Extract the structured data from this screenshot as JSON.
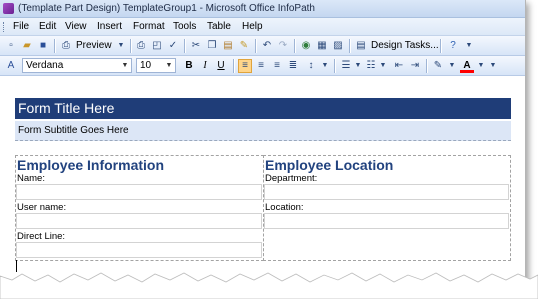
{
  "window": {
    "title": "(Template Part Design) TemplateGroup1 - Microsoft Office InfoPath"
  },
  "menu": {
    "items": [
      "File",
      "Edit",
      "View",
      "Insert",
      "Format",
      "Tools",
      "Table",
      "Help"
    ]
  },
  "toolbar_standard": {
    "preview_label": "Preview",
    "design_tasks_label": "Design Tasks...",
    "icons": [
      "new-icon",
      "open-icon",
      "save-icon",
      "preview-icon",
      "print-icon",
      "print-preview-icon",
      "spelling-icon",
      "cut-icon",
      "copy-icon",
      "paste-icon",
      "format-painter-icon",
      "undo-icon",
      "redo-icon",
      "insert-hyperlink-icon",
      "insert-table-icon",
      "insert-picture-icon",
      "design-tasks-icon",
      "help-icon",
      "toolbar-options-icon"
    ]
  },
  "toolbar_formatting": {
    "font_family": "Verdana",
    "font_size": "10",
    "bold_label": "B",
    "italic_label": "I",
    "underline_label": "U",
    "active_alignment": "align-left",
    "highlight_color": "#ffff00",
    "font_color": "#ff0000"
  },
  "form": {
    "title": "Form Title Here",
    "subtitle": "Form Subtitle Goes Here",
    "title_bg": "#1f3d78",
    "subtitle_bg": "#dce6f6",
    "sections": [
      {
        "heading": "Employee Information",
        "fields": [
          "Name:",
          "User name:",
          "Direct Line:"
        ]
      },
      {
        "heading": "Employee Location",
        "fields": [
          "Department:",
          "Location:"
        ]
      }
    ]
  }
}
